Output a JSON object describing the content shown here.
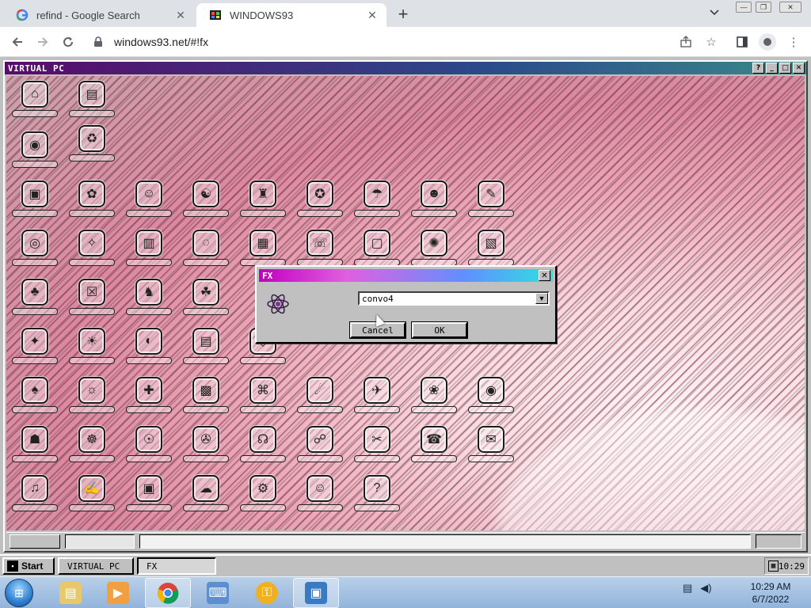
{
  "browser": {
    "tabs": [
      {
        "title": "refind - Google Search",
        "favicon": "google-icon"
      },
      {
        "title": "WINDOWS93",
        "favicon": "windows93-icon",
        "active": true
      }
    ],
    "url": "windows93.net/#!fx"
  },
  "virtual_pc": {
    "title": "VIRTUAL PC"
  },
  "dialog": {
    "title": "FX",
    "select_value": "convo4",
    "cancel_label": "Cancel",
    "ok_label": "OK"
  },
  "w93_taskbar": {
    "start_label": "Start",
    "tasks": [
      "VIRTUAL PC",
      "FX"
    ],
    "clock": "10:29"
  },
  "win7_taskbar": {
    "time": "10:29 AM",
    "date": "6/7/2022",
    "pinned": [
      "explorer-icon",
      "media-player-icon",
      "chrome-icon",
      "keyboard-icon",
      "refind-icon",
      "remote-desktop-icon"
    ]
  },
  "colors": {
    "chrome_tabstrip": "#dee1e6",
    "w93_gray": "#c0c0c0",
    "dialog_title_start": "#c000c0",
    "dialog_title_end": "#30e0e0"
  }
}
